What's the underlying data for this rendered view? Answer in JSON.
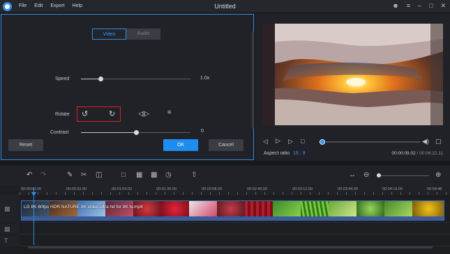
{
  "titlebar": {
    "menu": [
      "File",
      "Edit",
      "Export",
      "Help"
    ],
    "title": "Untitled"
  },
  "editor": {
    "tabs": [
      {
        "label": "Video"
      },
      {
        "label": "Audio"
      }
    ],
    "speed": {
      "label": "Speed",
      "value": "1.0x",
      "fraction": 0.18
    },
    "rotate": {
      "label": "Rotate"
    },
    "contrast": {
      "label": "Contrast",
      "value": "0",
      "fraction": 0.5
    },
    "buttons": {
      "reset": "Reset",
      "ok": "OK",
      "cancel": "Cancel"
    }
  },
  "preview": {
    "aspect_label": "Aspect ratio",
    "aspect_value": "16 : 9",
    "time_current": "00:00:09.02",
    "time_total": "/ 00:06:22.11",
    "progress_fraction": 0.02
  },
  "timeline": {
    "ruler_labels": [
      "00:00:00.00",
      "00:00:32.00",
      "00:01:04.00",
      "00:01:36.00",
      "00:02:08.00",
      "00:02:40.00",
      "00:03:12.00",
      "00:03:44.00",
      "00:04:16.00",
      "00:04:48"
    ],
    "clip_label": "LG 8K 60fps HDR NATURE 8K video ultra hd for 8K tv.mp4",
    "zoom_fraction": 0.0
  },
  "colors": {
    "accent": "#1f8cf0",
    "highlight_box": "#d9202a",
    "background": "#1d1f24"
  }
}
